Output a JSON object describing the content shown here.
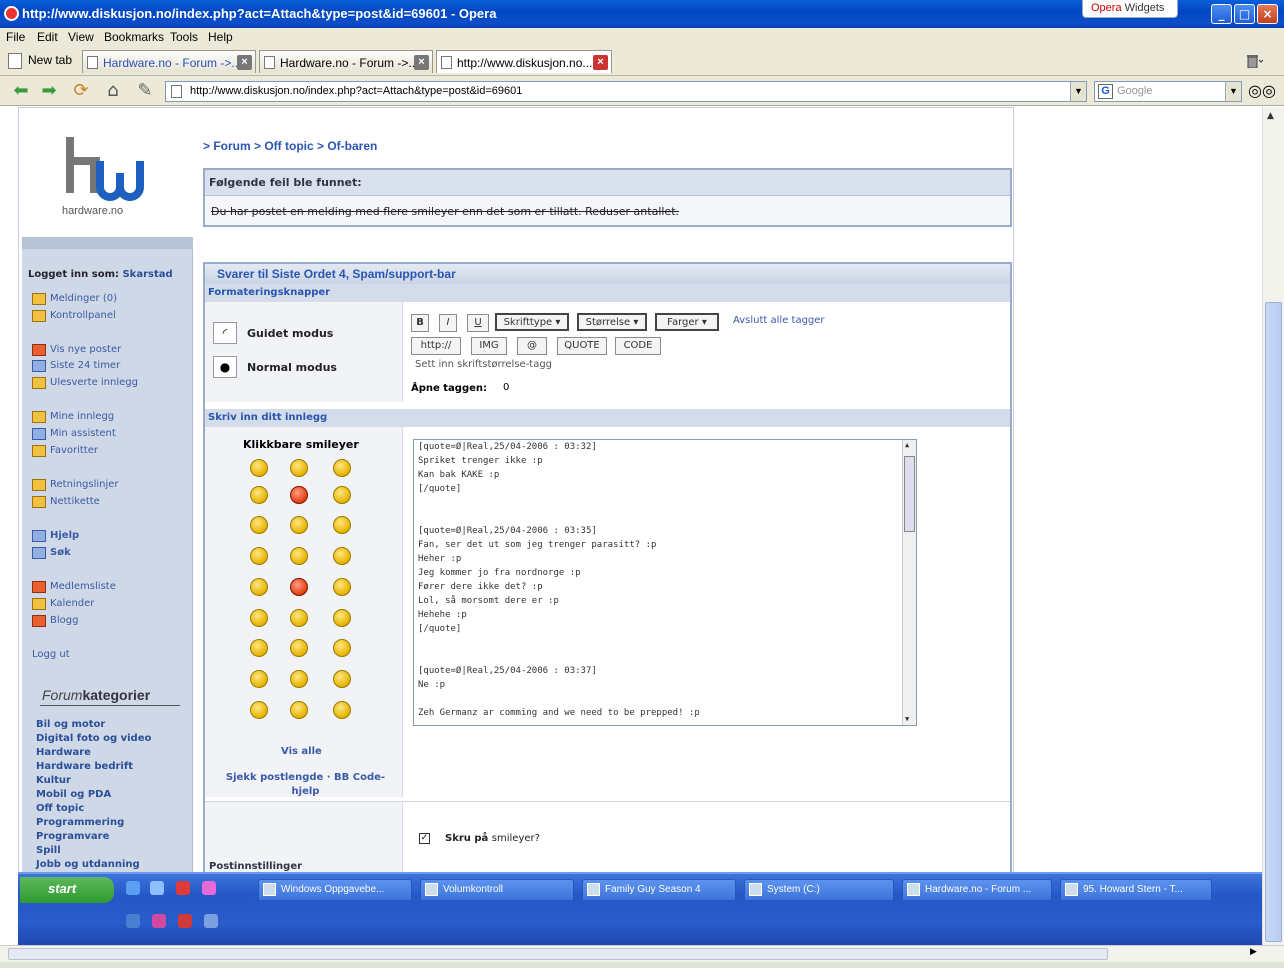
{
  "window": {
    "title": "http://www.diskusjon.no/index.php?act=Attach&type=post&id=69601 - Opera",
    "widgets_brand": "Opera",
    "widgets_label": "Widgets"
  },
  "menu": [
    "File",
    "Edit",
    "View",
    "Bookmarks",
    "Tools",
    "Help"
  ],
  "tabs": {
    "new_tab": "New tab",
    "items": [
      {
        "label": "Hardware.no - Forum ->..."
      },
      {
        "label": "Hardware.no - Forum ->..."
      },
      {
        "label": "http://www.diskusjon.no..."
      }
    ]
  },
  "address": {
    "url": "http://www.diskusjon.no/index.php?act=Attach&type=post&id=69601",
    "search_placeholder": "Google",
    "search_engine_letter": "G"
  },
  "sidebar": {
    "logo_text": "hardware.no",
    "login_prefix": "Logget inn som:",
    "username": "Skarstad",
    "groups": [
      [
        {
          "label": "Meldinger (0)",
          "icon": "envelope-icon"
        },
        {
          "label": "Kontrollpanel",
          "icon": "folder-icon"
        }
      ],
      [
        {
          "label": "Vis nye poster",
          "icon": "newposts-icon"
        },
        {
          "label": "Siste 24 timer",
          "icon": "calendar-icon"
        },
        {
          "label": "Ulesverte innlegg",
          "icon": "pencil-icon"
        }
      ],
      [
        {
          "label": "Mine innlegg",
          "icon": "pencil-icon"
        },
        {
          "label": "Min assistent",
          "icon": "window-icon"
        },
        {
          "label": "Favoritter",
          "icon": "folder-icon"
        }
      ],
      [
        {
          "label": "Retningslinjer",
          "icon": "folder-icon"
        },
        {
          "label": "Nettikette",
          "icon": "folder-icon"
        }
      ],
      [
        {
          "label": "Hjelp",
          "icon": "help-icon"
        },
        {
          "label": "Søk",
          "icon": "search-icon"
        }
      ],
      [
        {
          "label": "Medlemsliste",
          "icon": "members-icon"
        },
        {
          "label": "Kalender",
          "icon": "folder-icon"
        },
        {
          "label": "Blogg",
          "icon": "blog-icon"
        }
      ]
    ],
    "logout": "Logg ut",
    "forumcat_prefix": "Forum",
    "forumcat_suffix": "kategorier",
    "categories": [
      "Bil og motor",
      "Digital foto og video",
      "Hardware",
      "Hardware bedrift",
      "Kultur",
      "Mobil og PDA",
      "Off topic",
      "Programmering",
      "Programvare",
      "Spill",
      "Jobb og utdanning"
    ]
  },
  "breadcrumb": "> Forum > Off topic > Of-baren",
  "error": {
    "heading": "Følgende feil ble funnet:",
    "message": "Du har postet en melding med flere smileyer enn det som er tillatt. Reduser antallet."
  },
  "reply": {
    "title": "Svarer til Siste Ordet 4, Spam/support-bar",
    "format_heading": "Formateringsknapper",
    "guided_mode": "Guidet modus",
    "normal_mode": "Normal modus",
    "buttons": {
      "bold": "B",
      "italic": "I",
      "underline": "U",
      "font": "Skrifttype",
      "size": "Størrelse",
      "color": "Farger",
      "close_all": "Avslutt alle tagger",
      "http": "http://",
      "img": "IMG",
      "email": "@",
      "quote": "QUOTE",
      "code": "CODE"
    },
    "helpline": "Sett inn skriftstørrelse-tagg",
    "open_tags_label": "Åpne taggen:",
    "open_tags_value": "0",
    "write_heading": "Skriv inn ditt innlegg",
    "smileys_title": "Klikkbare smileyer",
    "show_all": "Vis alle",
    "bbcode_help": "Sjekk postlengde · BB Code-hjelp",
    "text_lines": [
      "[quote=Ø|Real,25/04-2006 : 03:32]",
      "Spriket trenger ikke :p",
      "Kan bak KAKE :p",
      "[/quote]",
      "",
      "",
      "[quote=Ø|Real,25/04-2006 : 03:35]",
      "Fan, ser det ut som jeg trenger parasitt? :p",
      "Heher :p",
      "Jeg kommer jo fra nordnorge :p",
      "Fører dere ikke det? :p",
      "Lol, så morsomt dere er :p",
      "Hehehe :p",
      "[/quote]",
      "",
      "",
      "[quote=Ø|Real,25/04-2006 : 03:37]",
      "Ne :p",
      "",
      "Zeh Germanz ar comming and we need to be prepped! :p"
    ],
    "enable_smileys": "Skru på",
    "enable_smileys_suffix": "smileyer?",
    "post_options": "Postinnstillinger"
  },
  "taskbar": {
    "start": "start",
    "items": [
      "Windows Oppgavebe...",
      "Volumkontroll",
      "Family Guy Season 4",
      "System (C:)",
      "Hardware.no - Forum ...",
      "95. Howard Stern - T..."
    ]
  }
}
